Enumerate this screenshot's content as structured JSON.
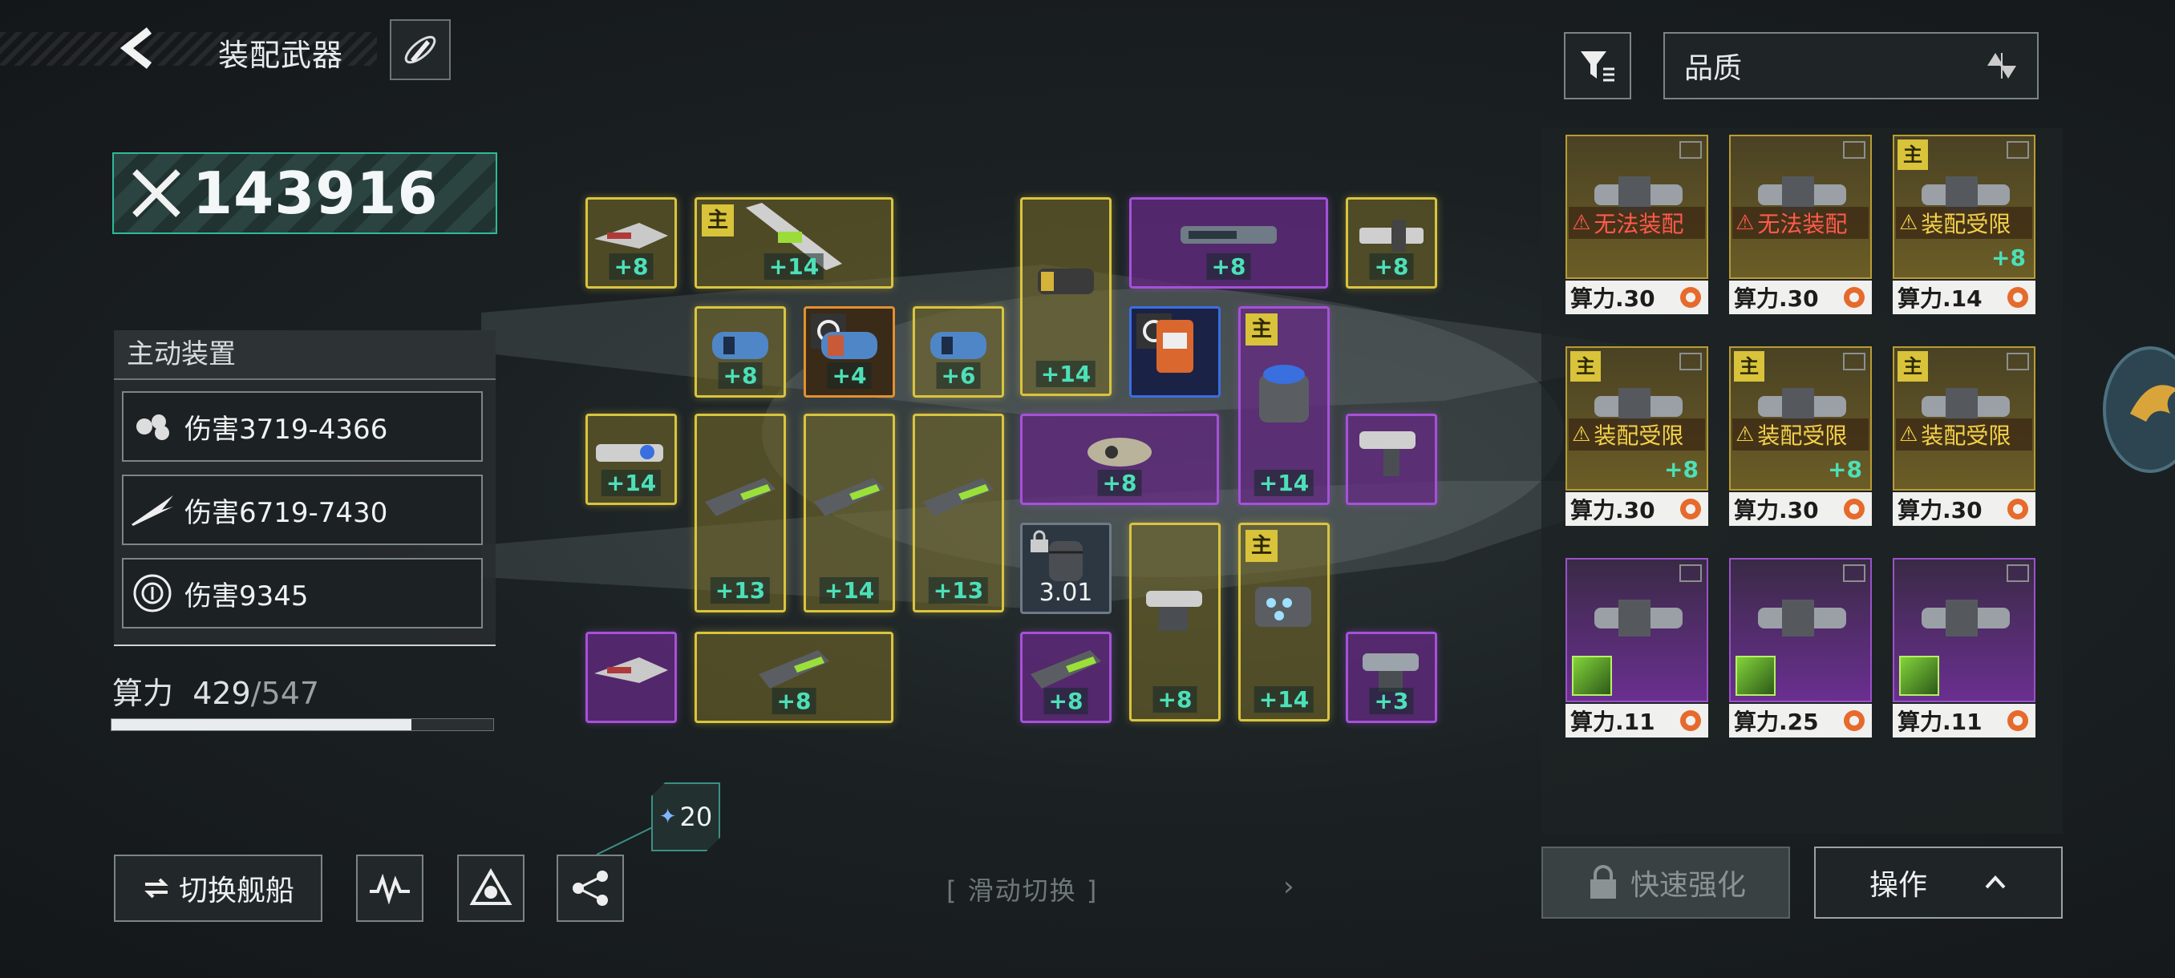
{
  "header": {
    "title": "装配武器"
  },
  "power": {
    "value": "143916"
  },
  "active_equipment": {
    "title": "主动装置",
    "items": [
      {
        "label": "伤害3719-4366",
        "icon": "turret-cluster-icon"
      },
      {
        "label": "伤害6719-7430",
        "icon": "slash-icon"
      },
      {
        "label": "伤害9345",
        "icon": "target-icon"
      }
    ]
  },
  "computing": {
    "label": "算力",
    "used": "429",
    "sep": "/",
    "max": "547",
    "fill_fraction": 0.785
  },
  "bottom": {
    "switch_ship": "切换舰船",
    "badge_count": "20",
    "swipe_hint": "[ 滑动切换 ]",
    "swipe_arrow": "›"
  },
  "grid": {
    "levels": {
      "l1": "+8",
      "l2": "+14",
      "l3": "+14",
      "l4": "+8",
      "l5": "+8",
      "l6": "+8",
      "l7": "+4",
      "l8": "+6",
      "l9": "+14",
      "l10": "+14",
      "l11": "+8",
      "l12": "+8",
      "l13": "+13",
      "l14": "+14",
      "l15": "+13",
      "l16": "+8",
      "l17": "+14",
      "l18": "+8",
      "l19": "+14",
      "l20": "+8",
      "l21": "+3"
    },
    "main_tag": "主",
    "locked_value": "3.01"
  },
  "right_panel": {
    "sort_label": "品质",
    "cards": [
      {
        "warn": "无法装配",
        "warn_color": "#ff5a4c",
        "cost": "算力.30"
      },
      {
        "warn": "无法装配",
        "warn_color": "#ff5a4c",
        "cost": "算力.30"
      },
      {
        "warn": "装配受限",
        "warn_color": "#f3d24a",
        "cost": "算力.14",
        "level": "+8"
      },
      {
        "warn": "装配受限",
        "warn_color": "#f3d24a",
        "cost": "算力.30",
        "level": "+8"
      },
      {
        "warn": "装配受限",
        "warn_color": "#f3d24a",
        "cost": "算力.30",
        "level": "+8"
      },
      {
        "warn": "装配受限",
        "warn_color": "#f3d24a",
        "cost": "算力.30"
      },
      {
        "cost": "算力.11"
      },
      {
        "cost": "算力.25"
      },
      {
        "cost": "算力.11"
      }
    ],
    "quick_enhance": "快速强化",
    "operate": "操作"
  }
}
